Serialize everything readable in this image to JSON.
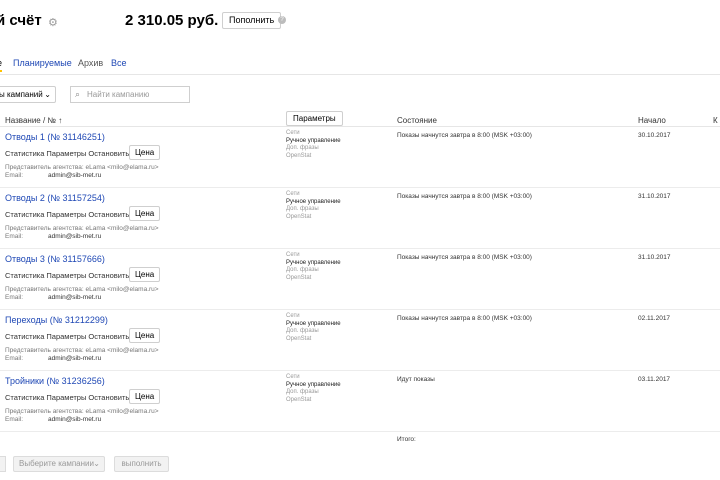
{
  "header": {
    "account_title": "й счёт",
    "balance": "2 310.05 руб.",
    "topup_label": "Пополнить"
  },
  "tabs": {
    "active_fragment": "е",
    "planned": "Планируемые",
    "archive": "Архив",
    "all": "Все"
  },
  "filter": {
    "campaign_select": "ы кампаний",
    "search_placeholder": "Найти кампанию"
  },
  "table": {
    "col_name": "Название / № ↑",
    "params_button": "Параметры",
    "col_status": "Состояние",
    "col_start": "Начало",
    "col_next_fragment": "К"
  },
  "row_labels": {
    "stats": "Статистика",
    "params": "Параметры",
    "stop": "Остановить",
    "price": "Цена",
    "agency_label": "Представитель агентства:",
    "agency_value": "eLama <milo@elama.ru>",
    "email_label": "Email:",
    "email_value": "admin@sib-met.ru",
    "nets": "Сети",
    "manual": "Ручное управление",
    "extra_phrases": "Доп. фразы",
    "openstat": "OpenStat"
  },
  "rows": [
    {
      "name": "Отводы 1",
      "num": "(№ 31146251)",
      "status": "Показы начнутся завтра в 8:00 (MSK +03:00)",
      "start": "30.10.2017"
    },
    {
      "name": "Отводы 2",
      "num": "(№ 31157254)",
      "status": "Показы начнутся завтра в 8:00 (MSK +03:00)",
      "start": "31.10.2017"
    },
    {
      "name": "Отводы 3",
      "num": "(№ 31157666)",
      "status": "Показы начнутся завтра в 8:00 (MSK +03:00)",
      "start": "31.10.2017"
    },
    {
      "name": "Переходы",
      "num": "(№ 31212299)",
      "status": "Показы начнутся завтра в 8:00 (MSK +03:00)",
      "start": "02.11.2017"
    },
    {
      "name": "Тройники",
      "num": "(№ 31236256)",
      "status": "Идут показы",
      "start": "03.11.2017"
    }
  ],
  "footer": {
    "total": "Итого:",
    "choose_campaigns": "Выберите кампании",
    "execute": "выполнить"
  }
}
